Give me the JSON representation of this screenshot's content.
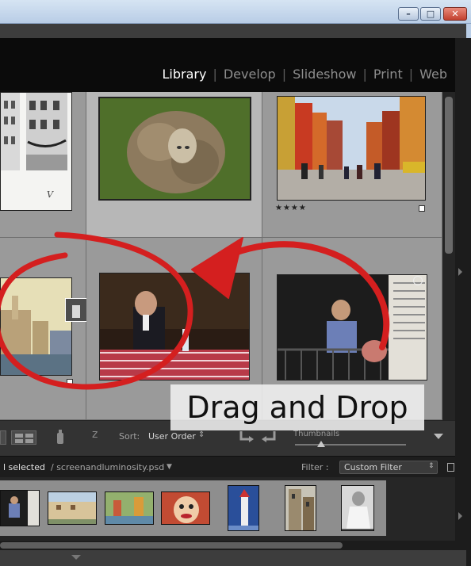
{
  "window": {
    "minimize_glyph": "–",
    "maximize_glyph": "□",
    "close_glyph": "✕"
  },
  "modules": {
    "items": [
      {
        "label": "Library",
        "active": true
      },
      {
        "label": "Develop",
        "active": false
      },
      {
        "label": "Slideshow",
        "active": false
      },
      {
        "label": "Print",
        "active": false
      },
      {
        "label": "Web",
        "active": false
      }
    ],
    "separator": "|"
  },
  "grid": {
    "rating_stars": "★★★★"
  },
  "toolbar": {
    "sort_label": "Sort:",
    "sort_value": "User Order",
    "sort_arrow": "⇕",
    "thumbnails_label": "Thumbnails",
    "az_icon": "z"
  },
  "filmstrip_header": {
    "selected": "l selected",
    "filename": "/ screenandluminosity.psd",
    "file_arrow": "▼",
    "filter_label": "Filter :",
    "filter_value": "Custom Filter",
    "filter_arrow": "⇕"
  },
  "annotation": {
    "caption": "Drag and Drop",
    "arrow_color": "#d41f1f"
  }
}
